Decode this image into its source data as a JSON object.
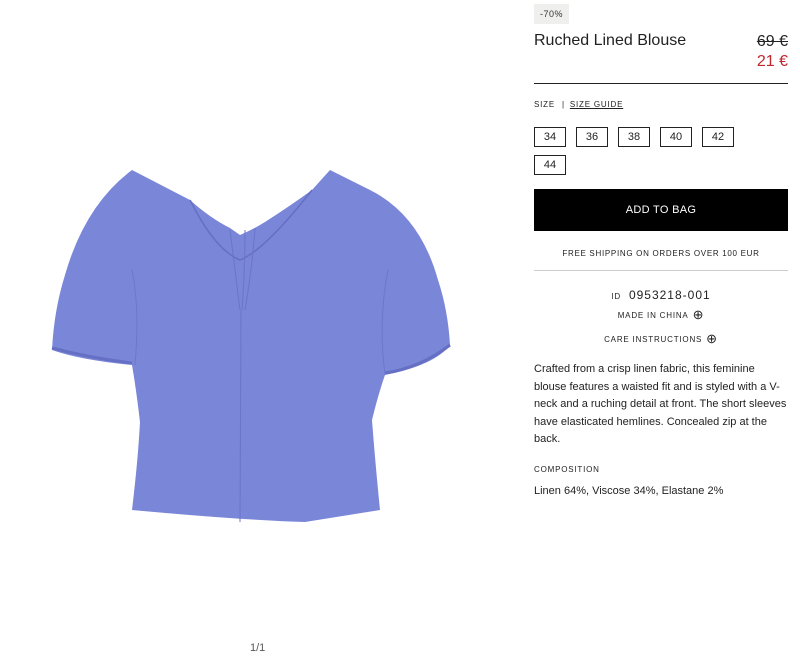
{
  "product": {
    "discount": "-70%",
    "title": "Ruched Lined Blouse",
    "old_price": "69 €",
    "new_price": "21 €",
    "image_color": "#7a86d8"
  },
  "size": {
    "label": "SIZE",
    "separator": "|",
    "guide_label": "SIZE GUIDE",
    "options": [
      "34",
      "36",
      "38",
      "40",
      "42",
      "44"
    ]
  },
  "actions": {
    "add_to_bag": "ADD TO BAG"
  },
  "shipping": "FREE SHIPPING ON ORDERS OVER 100 EUR",
  "article": {
    "label": "ID",
    "value": "0953218-001"
  },
  "info": {
    "made_in": "MADE IN CHINA",
    "care": "CARE INSTRUCTIONS",
    "plus_icon": "⊕"
  },
  "description": "Crafted from a crisp linen fabric, this feminine blouse features a waisted fit and is styled with a V-neck and a ruching detail at front. The short sleeves have elasticated hemlines. Concealed zip at the back.",
  "composition": {
    "label": "COMPOSITION",
    "value": "Linen 64%, Viscose 34%, Elastane 2%"
  },
  "gallery": {
    "pager": "1/1"
  }
}
